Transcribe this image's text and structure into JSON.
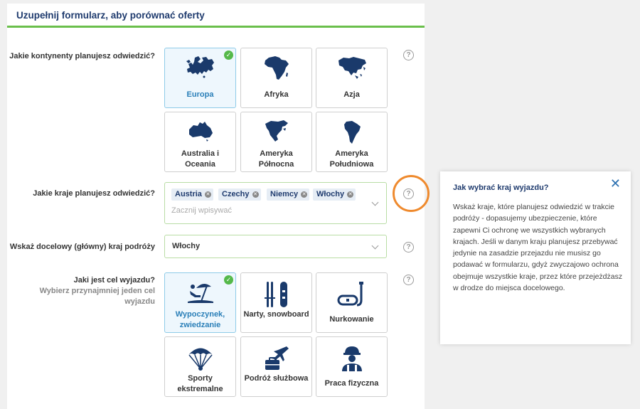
{
  "header": {
    "title": "Uzupełnij formularz, aby porównać oferty"
  },
  "continents": {
    "label": "Jakie kontynenty planujesz odwiedzić?",
    "items": [
      {
        "label": "Europa",
        "icon": "europe-map-icon",
        "selected": true
      },
      {
        "label": "Afryka",
        "icon": "africa-map-icon",
        "selected": false
      },
      {
        "label": "Azja",
        "icon": "asia-map-icon",
        "selected": false
      },
      {
        "label": "Australia i Oceania",
        "icon": "australia-map-icon",
        "selected": false
      },
      {
        "label": "Ameryka Północna",
        "icon": "north-america-map-icon",
        "selected": false
      },
      {
        "label": "Ameryka Południowa",
        "icon": "south-america-map-icon",
        "selected": false
      }
    ]
  },
  "countries": {
    "label": "Jakie kraje planujesz odwiedzić?",
    "chips": [
      "Austria",
      "Czechy",
      "Niemcy",
      "Włochy"
    ],
    "placeholder": "Zacznij wpisywać"
  },
  "destination": {
    "label": "Wskaż docelowy (główny) kraj podróży",
    "value": "Włochy"
  },
  "purpose": {
    "label": "Jaki jest cel wyjazdu?",
    "sublabel": "Wybierz przynajmniej jeden cel wyjazdu",
    "items": [
      {
        "label": "Wypoczynek, zwiedzanie",
        "icon": "beach-umbrella-icon",
        "selected": true
      },
      {
        "label": "Narty, snowboard",
        "icon": "skis-icon",
        "selected": false
      },
      {
        "label": "Nurkowanie",
        "icon": "diving-mask-icon",
        "selected": false
      },
      {
        "label": "Sporty ekstremalne",
        "icon": "parachute-icon",
        "selected": false
      },
      {
        "label": "Podróż służbowa",
        "icon": "briefcase-plane-icon",
        "selected": false
      },
      {
        "label": "Praca fizyczna",
        "icon": "worker-helmet-icon",
        "selected": false
      }
    ]
  },
  "tooltip": {
    "title": "Jak wybrać kraj wyjazdu?",
    "close": "✕",
    "body": "Wskaż kraje, które planujesz odwiedzić w trakcie podróży - dopasujemy ubezpieczenie, które zapewni Ci ochronę we wszystkich wybranych krajach. Jeśli w danym kraju planujesz przebywać jedynie na zasadzie przejazdu nie musisz go podawać w formularzu, gdyż zwyczajowo ochrona obejmuje wszystkie kraje, przez które przejeżdżasz w drodze do miejsca docelowego."
  },
  "help_glyph": "?",
  "colors": {
    "accent_green": "#6abf4b",
    "navy": "#1f3b6e",
    "icon_navy": "#1a3a6b",
    "highlight_orange": "#ef8a2e",
    "check_green": "#55b94a"
  }
}
